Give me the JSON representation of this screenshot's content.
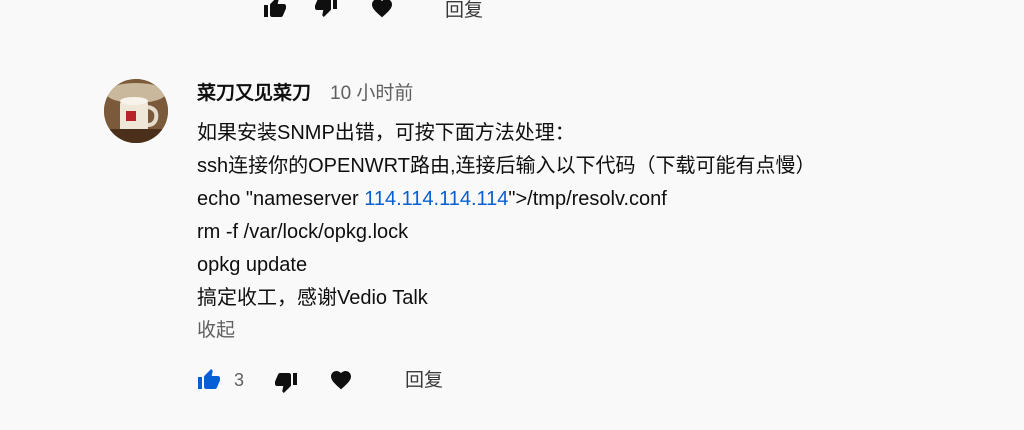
{
  "previous_comment_actions": {
    "like_icon": "thumb-up-icon",
    "dislike_icon": "thumb-down-icon",
    "heart_icon": "heart-icon",
    "reply_label": "回复"
  },
  "comment": {
    "author": "菜刀又见菜刀",
    "timestamp": "10 小时前",
    "lines": [
      "如果安装SNMP出错，可按下面方法处理：",
      "ssh连接你的OPENWRT路由,连接后输入以下代码（下载可能有点慢）",
      {
        "prefix": "echo \"nameserver ",
        "link": "114.114.114.114",
        "suffix": "\">/tmp/resolv.conf"
      },
      "rm -f /var/lock/opkg.lock",
      "opkg update",
      "搞定收工，感谢Vedio Talk"
    ],
    "collapse_label": "收起",
    "actions": {
      "like_count": "3",
      "reply_label": "回复"
    }
  },
  "colors": {
    "background": "#f9f9f9",
    "text": "#0f0f0f",
    "muted": "#606060",
    "link": "#065fd4",
    "liked": "#065fd4"
  }
}
